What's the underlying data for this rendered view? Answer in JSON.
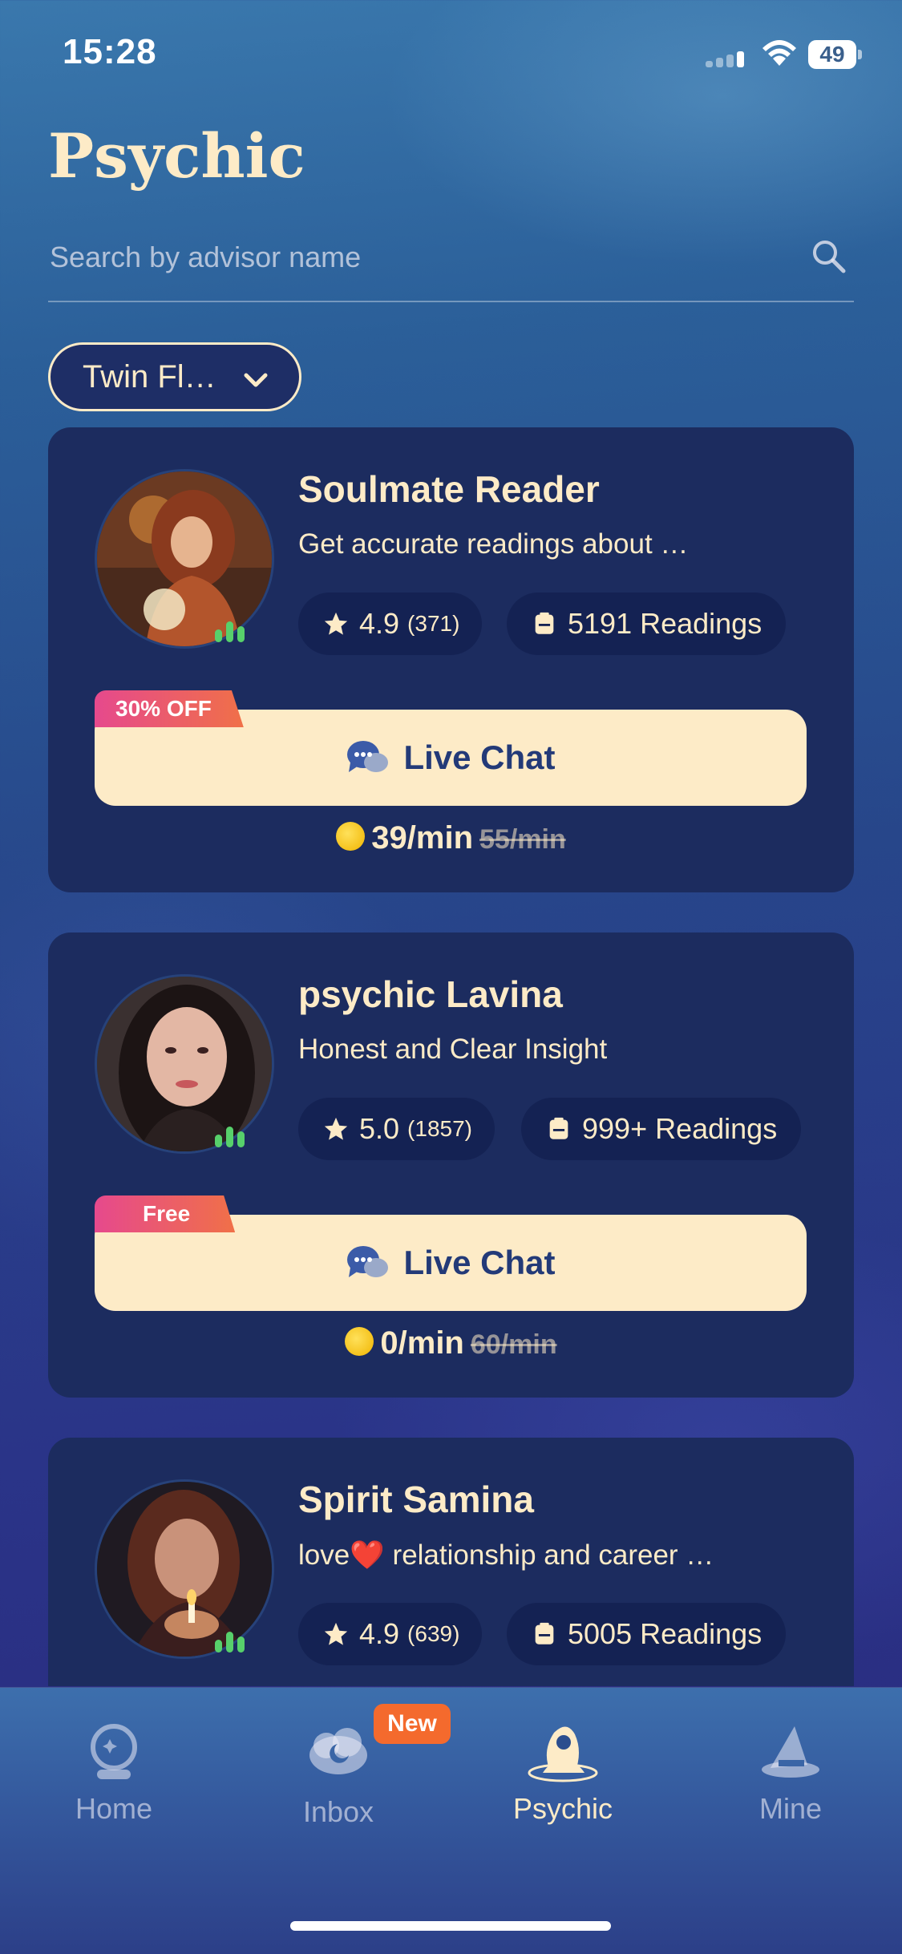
{
  "status_bar": {
    "time": "15:28",
    "battery": "49"
  },
  "page": {
    "title": "Psychic"
  },
  "search": {
    "placeholder": "Search by advisor name"
  },
  "filter": {
    "label": "Twin Fl…"
  },
  "advisors": [
    {
      "name": "Soulmate Reader",
      "tagline": "Get accurate readings about …",
      "rating": "4.9",
      "rating_count": "(371)",
      "readings": "5191 Readings",
      "promo": "30% OFF",
      "chat_label": "Live Chat",
      "price": "39/min",
      "old_price": "55/min"
    },
    {
      "name": "psychic Lavina",
      "tagline": "Honest and Clear Insight",
      "rating": "5.0",
      "rating_count": "(1857)",
      "readings": "999+ Readings",
      "promo": "Free",
      "chat_label": "Live Chat",
      "price": "0/min",
      "old_price": "60/min"
    },
    {
      "name": "Spirit Samina",
      "tagline_before": "love",
      "tagline_emoji": "❤️",
      "tagline_after": " relationship and career …",
      "rating": "4.9",
      "rating_count": "(639)",
      "readings": "5005 Readings"
    }
  ],
  "tabs": [
    {
      "label": "Home",
      "icon": "crystal-ball-icon"
    },
    {
      "label": "Inbox",
      "icon": "cloud-moon-icon",
      "badge": "New"
    },
    {
      "label": "Psychic",
      "icon": "psychic-woman-icon",
      "active": true
    },
    {
      "label": "Mine",
      "icon": "wizard-hat-icon"
    }
  ],
  "colors": {
    "accent": "#fdebc7",
    "card": "#1c2c5f",
    "online": "#57d06b",
    "badge_new": "#f46a2d"
  }
}
